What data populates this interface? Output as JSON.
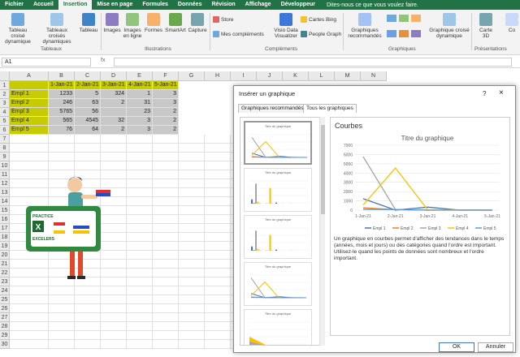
{
  "tabs": [
    "Fichier",
    "Accueil",
    "Insertion",
    "Mise en page",
    "Formules",
    "Données",
    "Révision",
    "Affichage",
    "Développeur"
  ],
  "active_tab": "Insertion",
  "tell_me": "Dites-nous ce que vous voulez faire.",
  "ribbon": {
    "pivot": "Tableau croisé dynamique",
    "recommended_pivots": "Tableaux croisés dynamiques",
    "table": "Tableau",
    "group_tables": "Tableaux",
    "images": "Images",
    "online_images": "Images en ligne",
    "shapes": "Formes",
    "smartart": "SmartArt",
    "capture": "Capture",
    "group_illustrations": "Illustrations",
    "store": "Store",
    "my_addins": "Mes compléments",
    "visio": "Visio Data Visualizer",
    "bing": "Cartes Bing",
    "people": "People Graph",
    "group_addins": "Compléments",
    "rec_charts": "Graphiques recommandés",
    "pivot_chart": "Graphique croisé dynamique",
    "map3d": "Carte 3D",
    "group_charts": "Graphiques",
    "group_tours": "Présentations",
    "co": "Co"
  },
  "namebox": "A1",
  "fx": "fx",
  "columns": [
    "A",
    "B",
    "C",
    "D",
    "E",
    "F",
    "G",
    "H",
    "I",
    "J",
    "K",
    "L",
    "M",
    "N"
  ],
  "rows": [
    "1",
    "2",
    "3",
    "4",
    "5",
    "6",
    "7",
    "8",
    "9",
    "10",
    "11",
    "12",
    "13",
    "14",
    "15",
    "16",
    "17",
    "18",
    "19",
    "20",
    "21",
    "22",
    "23",
    "24",
    "25",
    "26",
    "27",
    "28",
    "29",
    "30"
  ],
  "table": {
    "header": [
      "",
      "1-Jan-21",
      "2-Jan-21",
      "3-Jan-21",
      "4-Jan-21",
      "5-Jan-21"
    ],
    "rows": [
      [
        "Empl 1",
        "1233",
        "5",
        "324",
        "1",
        "3"
      ],
      [
        "Empl 2",
        "246",
        "63",
        "2",
        "31",
        "3"
      ],
      [
        "Empl 3",
        "5765",
        "56",
        "",
        "23",
        "2"
      ],
      [
        "Empl 4",
        "565",
        "4545",
        "32",
        "3",
        "2"
      ],
      [
        "Empl 5",
        "76",
        "64",
        "2",
        "3",
        "2"
      ]
    ]
  },
  "logo_text": [
    "PRACTICE",
    "EXCELERS"
  ],
  "dialog": {
    "title": "Insérer un graphique",
    "help": "?",
    "close": "×",
    "tab_recommended": "Graphiques recommandés",
    "tab_all": "Tous les graphiques",
    "thumb_title": "Titre du graphique",
    "chart_type_name": "Courbes",
    "description": "Un graphique en courbes permet d'afficher des tendances dans le temps (années, mois et jours) ou des catégories quand l'ordre est important. Utilisez-le quand les points de données sont nombreux et l'ordre important.",
    "ok": "OK",
    "cancel": "Annuler"
  },
  "chart_data": {
    "type": "line",
    "title": "Titre du graphique",
    "categories": [
      "1-Jan-21",
      "2-Jan-21",
      "3-Jan-21",
      "4-Jan-21",
      "5-Jan-21"
    ],
    "ylim": [
      0,
      7000
    ],
    "yticks": [
      "0",
      "1000",
      "2000",
      "3000",
      "4000",
      "5000",
      "6000",
      "7000"
    ],
    "series": [
      {
        "name": "Empl 1",
        "values": [
          1233,
          5,
          324,
          1,
          3
        ],
        "color": "#4472c4"
      },
      {
        "name": "Empl 2",
        "values": [
          246,
          63,
          2,
          31,
          3
        ],
        "color": "#ed7d31"
      },
      {
        "name": "Empl 3",
        "values": [
          5765,
          56,
          0,
          23,
          2
        ],
        "color": "#a5a5a5"
      },
      {
        "name": "Empl 4",
        "values": [
          565,
          4545,
          32,
          3,
          2
        ],
        "color": "#ffc000"
      },
      {
        "name": "Empl 5",
        "values": [
          76,
          64,
          2,
          3,
          2
        ],
        "color": "#5b9bd5"
      }
    ],
    "legend": "bottom"
  }
}
